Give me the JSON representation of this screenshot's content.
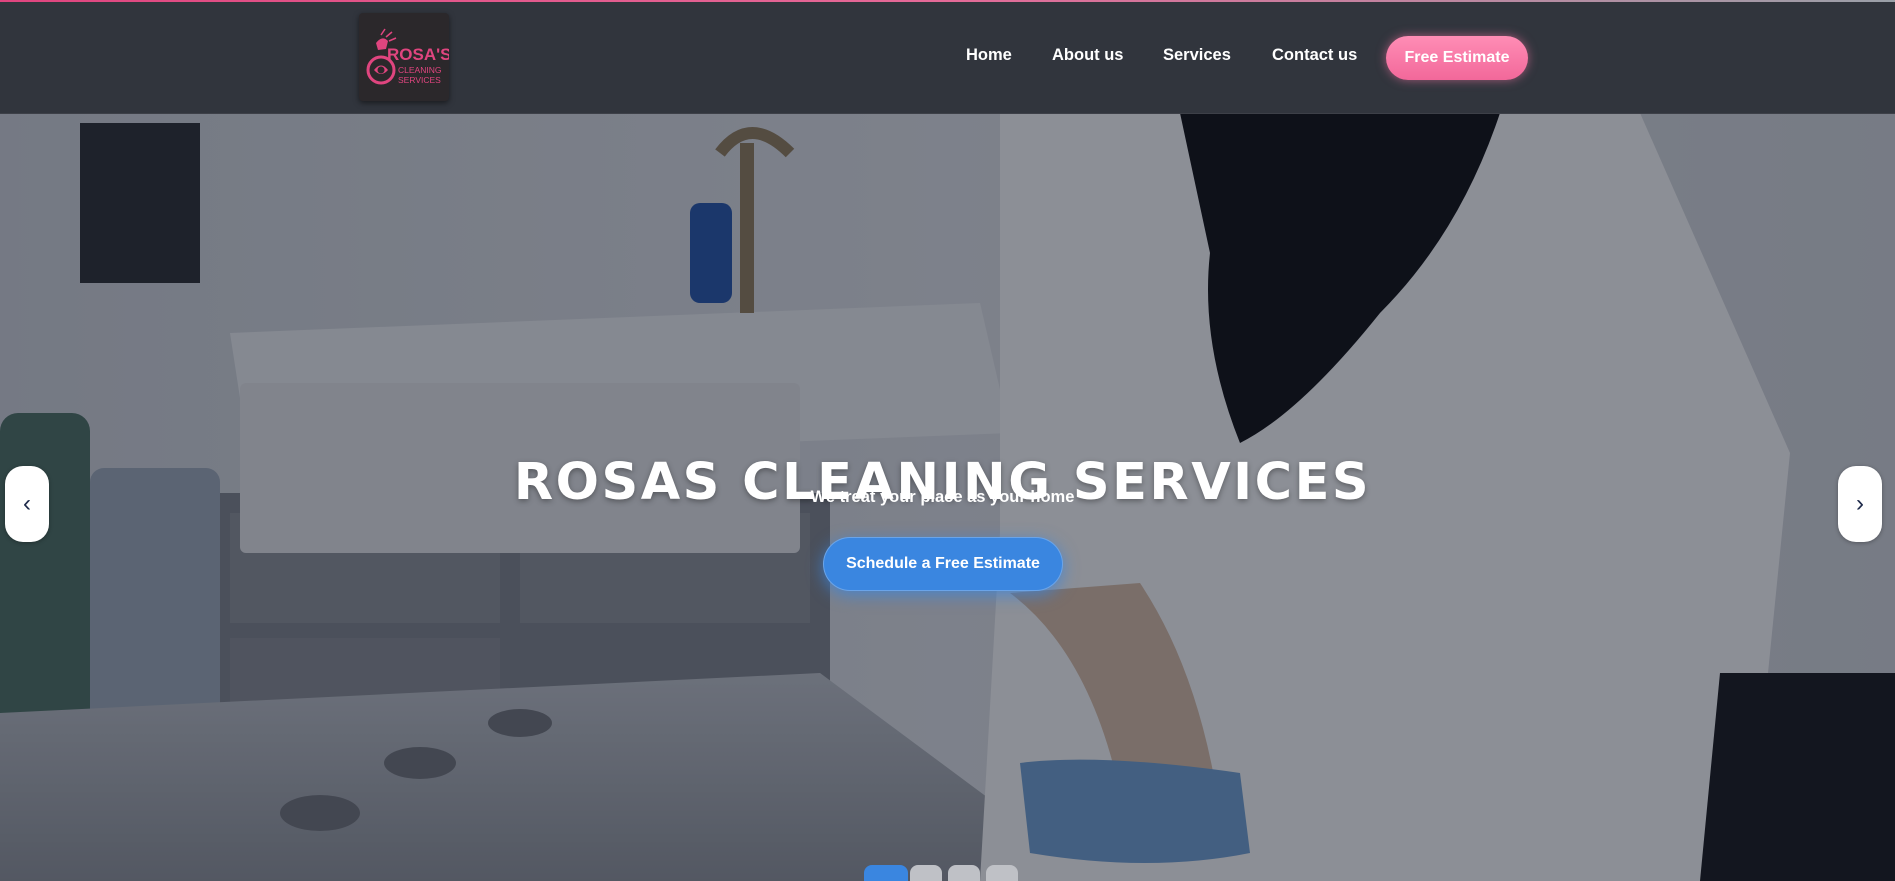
{
  "header": {
    "logo": {
      "name": "Rosa's Cleaning Services logo",
      "line1": "ROSA'S",
      "line2": "CLEANING",
      "line3": "SERVICES",
      "color": "#e0457f"
    },
    "nav": [
      {
        "label": "Home"
      },
      {
        "label": "About us"
      },
      {
        "label": "Services"
      },
      {
        "label": "Contact us"
      }
    ],
    "cta_label": "Free Estimate"
  },
  "hero": {
    "title": "ROSAS CLEANING SERVICES",
    "subtitle": "We treat your place as your home",
    "cta_label": "Schedule a Free Estimate",
    "prev_icon": "‹",
    "next_icon": "›",
    "slides": {
      "count": 4,
      "active": 1
    }
  },
  "colors": {
    "accent_pink": "#f2689a",
    "accent_blue": "#3a86e0",
    "navbar_bg": "#31353d"
  }
}
